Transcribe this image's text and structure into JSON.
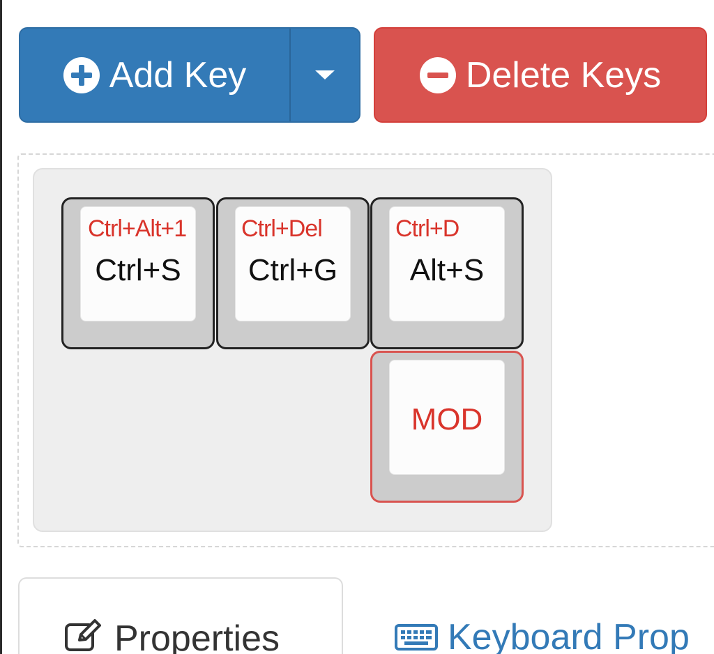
{
  "toolbar": {
    "add_key_label": "Add Key",
    "delete_keys_label": "Delete Keys",
    "add_icon": "plus-circle-icon",
    "delete_icon": "minus-circle-icon",
    "dropdown_icon": "caret-down-icon",
    "primary_color": "#337ab7",
    "danger_color": "#d9534f"
  },
  "keyboard": {
    "keys": [
      {
        "top_legend": "Ctrl+Alt+1",
        "main_legend": "Ctrl+S",
        "selected": false
      },
      {
        "top_legend": "Ctrl+Del",
        "main_legend": "Ctrl+G",
        "selected": false
      },
      {
        "top_legend": "Ctrl+D",
        "main_legend": "Alt+S",
        "selected": false
      },
      {
        "top_legend": "",
        "center_legend": "MOD",
        "selected": true
      }
    ],
    "legend_accent_color": "#d9342b"
  },
  "tabs": [
    {
      "label": "Properties",
      "icon": "edit-icon",
      "active": true
    },
    {
      "label": "Keyboard Prop",
      "icon": "keyboard-icon",
      "active": false
    }
  ]
}
